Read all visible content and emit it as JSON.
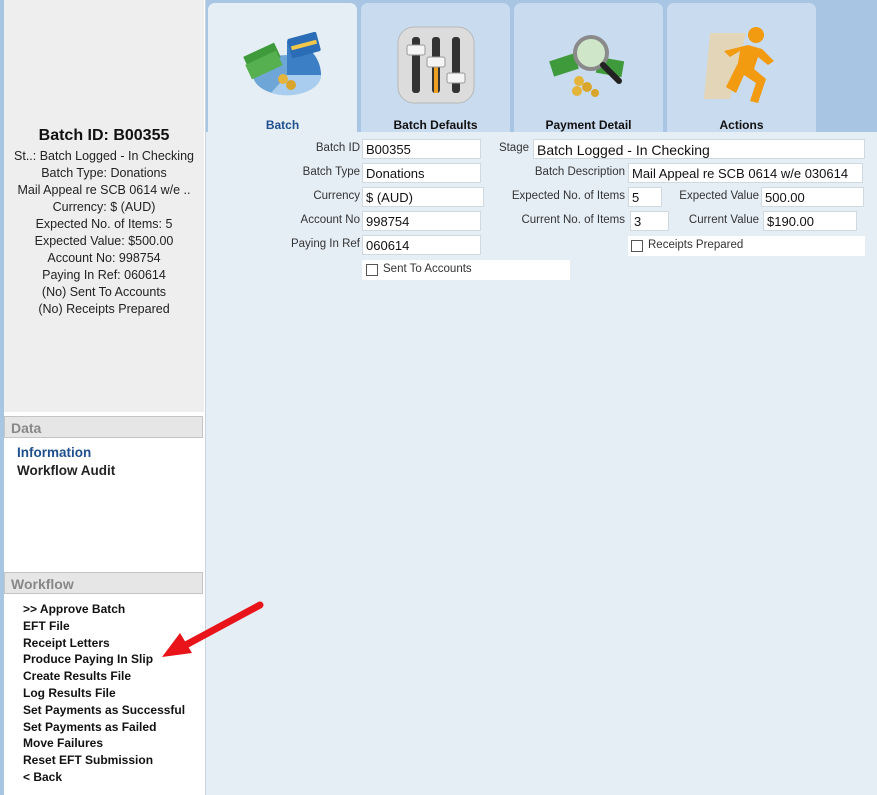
{
  "summary": {
    "batch_id": "Batch ID: B00355",
    "lines": [
      "St..: Batch Logged - In Checking",
      "Batch Type: Donations",
      "Mail Appeal re SCB 0614 w/e ..",
      "Currency: $ (AUD)",
      "Expected No. of Items: 5",
      "Expected Value: $500.00",
      "Account No: 998754",
      "Paying In Ref: 060614",
      "(No) Sent To Accounts",
      "(No) Receipts Prepared"
    ]
  },
  "data_section": {
    "title": "Data",
    "items": [
      "Information",
      "Workflow Audit"
    ]
  },
  "workflow_section": {
    "title": "Workflow",
    "items": [
      ">> Approve Batch",
      "EFT File",
      "Receipt Letters",
      "Produce Paying In Slip",
      "Create Results File",
      "Log Results File",
      "Set Payments as Successful",
      "Set Payments as Failed",
      "Move Failures",
      "Reset EFT Submission",
      "< Back"
    ]
  },
  "tabs": [
    {
      "label": "Batch",
      "icon": "money-credit-card-pie-icon"
    },
    {
      "label": "Batch Defaults",
      "icon": "mixer-sliders-icon"
    },
    {
      "label": "Payment Detail",
      "icon": "money-magnifier-icon"
    },
    {
      "label": "Actions",
      "icon": "running-man-icon"
    }
  ],
  "form": {
    "batch_id": {
      "label": "Batch ID",
      "value": "B00355"
    },
    "batch_type": {
      "label": "Batch Type",
      "value": "Donations"
    },
    "currency": {
      "label": "Currency",
      "value": "$ (AUD)"
    },
    "account_no": {
      "label": "Account No",
      "value": "998754"
    },
    "paying_in_ref": {
      "label": "Paying In Ref",
      "value": "060614"
    },
    "stage": {
      "label": "Stage",
      "value": "Batch Logged - In Checking"
    },
    "batch_description": {
      "label": "Batch Description",
      "value": "Mail Appeal re SCB 0614 w/e 030614"
    },
    "expected_items": {
      "label": "Expected No. of Items",
      "value": "5"
    },
    "expected_value": {
      "label": "Expected Value",
      "value": "500.00"
    },
    "current_items": {
      "label": "Current No. of Items",
      "value": "3"
    },
    "current_value": {
      "label": "Current Value",
      "value": "$190.00"
    },
    "receipts_prepared": {
      "label": "Receipts Prepared",
      "checked": false
    },
    "sent_to_accounts": {
      "label": "Sent To Accounts",
      "checked": false
    }
  },
  "annotation": {
    "arrow_color": "#e8141a",
    "points_to": "Produce Paying In Slip"
  }
}
